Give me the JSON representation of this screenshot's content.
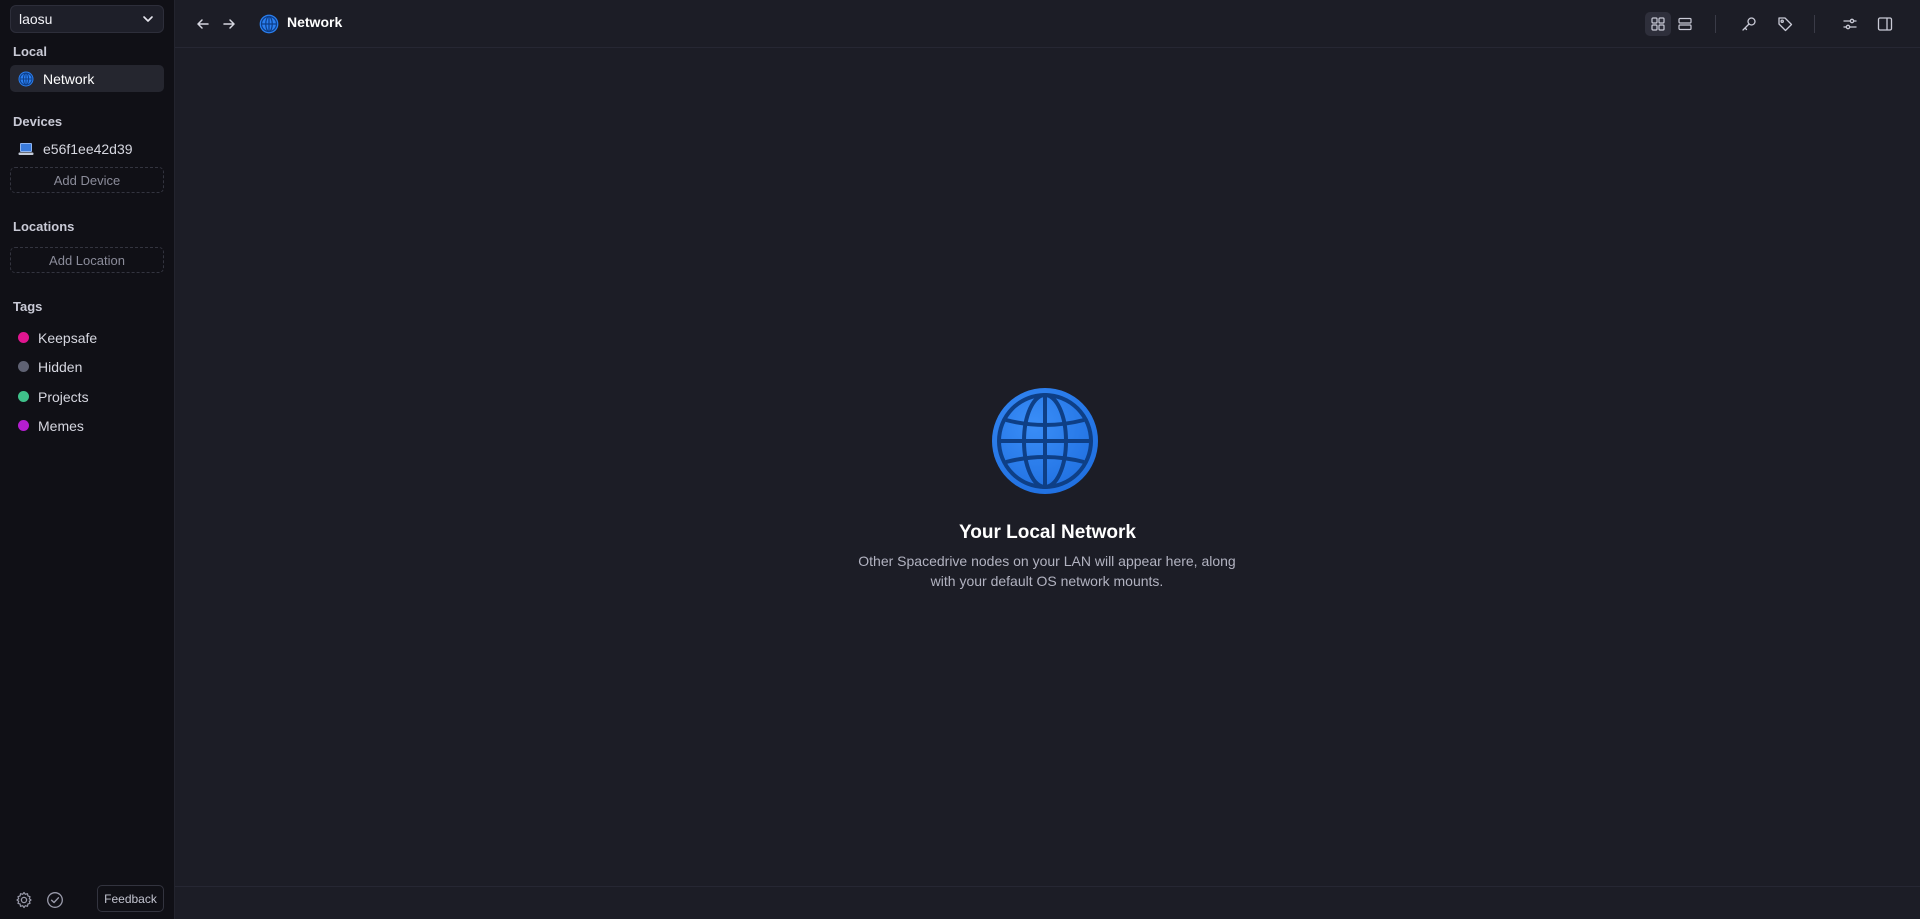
{
  "sidebar": {
    "library": "laosu",
    "sections": {
      "local": "Local",
      "devices": "Devices",
      "locations": "Locations",
      "tags": "Tags"
    },
    "local_items": [
      {
        "label": "Network",
        "icon": "globe-icon"
      }
    ],
    "devices": [
      {
        "label": "e56f1ee42d39",
        "icon": "laptop-icon"
      }
    ],
    "add_device": "Add Device",
    "add_location": "Add Location",
    "tags": [
      {
        "label": "Keepsafe",
        "color": "#e0158f"
      },
      {
        "label": "Hidden",
        "color": "#5f6273"
      },
      {
        "label": "Projects",
        "color": "#3fc18a"
      },
      {
        "label": "Memes",
        "color": "#b41ed0"
      }
    ],
    "feedback": "Feedback"
  },
  "topbar": {
    "title": "Network",
    "icons": [
      "arrow-left-icon",
      "arrow-right-icon",
      "grid-view-icon",
      "list-view-icon",
      "key-icon",
      "tag-icon",
      "sliders-icon",
      "panel-icon"
    ]
  },
  "main": {
    "empty_title": "Your Local Network",
    "empty_line1": "Other Spacedrive nodes on your LAN will appear here, along",
    "empty_line2": "with your default OS network mounts."
  },
  "colors": {
    "accent": "#2b7ff0",
    "background": "#1c1d26",
    "sidebar": "#101016"
  }
}
